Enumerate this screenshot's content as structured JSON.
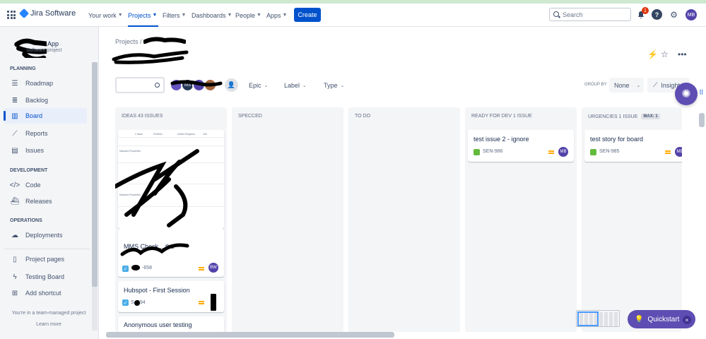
{
  "topnav": {
    "app_name": "Jira Software",
    "items": [
      "Your work",
      "Projects",
      "Filters",
      "Dashboards",
      "People",
      "Apps"
    ],
    "create_label": "Create",
    "search_placeholder": "Search",
    "notification_count": "1",
    "user_initials": "MB"
  },
  "sidebar": {
    "project_name": "App",
    "project_type": "Software project",
    "planning_head": "PLANNING",
    "planning": [
      "Roadmap",
      "Backlog",
      "Board",
      "Reports",
      "Issues"
    ],
    "development_head": "DEVELOPMENT",
    "development": [
      "Code",
      "Releases"
    ],
    "operations_head": "OPERATIONS",
    "operations": [
      "Deployments"
    ],
    "extra": [
      "Project pages",
      "Testing Board",
      "Add shortcut"
    ],
    "footer_text": "You're in a team-managed project",
    "learn_more": "Learn more"
  },
  "breadcrumb": {
    "projects": "Projects",
    "sep": "/"
  },
  "filters": {
    "epic": "Epic",
    "label": "Label",
    "type": "Type",
    "avatar_text": "MS"
  },
  "groupby": {
    "label": "GROUP BY",
    "value": "None"
  },
  "insights_label": "Insights",
  "columns": [
    {
      "title": "IDEAS 43 ISSUES"
    },
    {
      "title": "SPECCED"
    },
    {
      "title": "TO DO"
    },
    {
      "title": "READY FOR DEV 1 ISSUE"
    },
    {
      "title": "URGENCIES 1 ISSUE",
      "max": "MAX: 1"
    }
  ],
  "cards": {
    "ideas": [
      {
        "title": "MMS Check... the",
        "key": "-658",
        "assignee": "BW"
      },
      {
        "title": "Hubspot - First Session",
        "key": "S -594"
      },
      {
        "title": "Anonymous user testing"
      }
    ],
    "ready": {
      "title": "test issue 2 - ignore",
      "key": "SEN-986",
      "assignee": "MB"
    },
    "urgent": {
      "title": "test story for board",
      "key": "SEN-985",
      "assignee": "MB"
    }
  },
  "mini_table_text": {
    "a": "2 issue",
    "b": "Portfolio",
    "c": "United Kingdom",
    "d": "100",
    "e": "Misused Properties"
  },
  "quickstart": {
    "label": "Quickstart",
    "close": "×"
  },
  "colors": {
    "primary": "#0052cc",
    "purple": "#5e4db2",
    "story": "#63ba3c",
    "task": "#4bade8",
    "priority": "#ffab00"
  }
}
